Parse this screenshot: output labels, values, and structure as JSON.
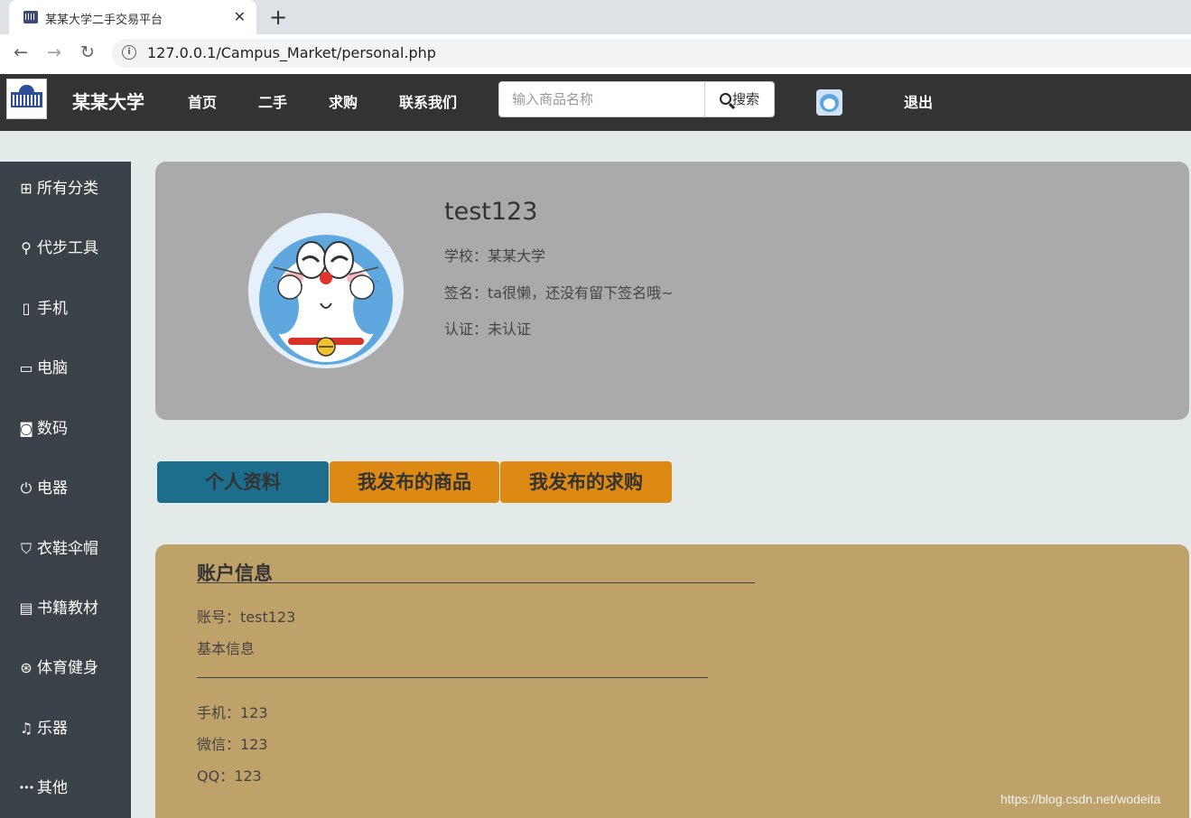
{
  "browser": {
    "tab_title": "某某大学二手交易平台",
    "tab_close": "✕",
    "new_tab": "+",
    "url": "127.0.0.1/Campus_Market/personal.php",
    "back": "←",
    "forward": "→",
    "reload": "↻"
  },
  "header": {
    "brand": "某某大学",
    "nav": [
      "首页",
      "二手",
      "求购",
      "联系我们"
    ],
    "search_placeholder": "输入商品名称",
    "search_button": "搜索",
    "logout": "退出"
  },
  "sidebar": {
    "items": [
      {
        "icon": "grid-icon",
        "glyph": "⊞",
        "label": "所有分类"
      },
      {
        "icon": "bicycle-icon",
        "glyph": "⚲",
        "label": "代步工具"
      },
      {
        "icon": "phone-icon",
        "glyph": "▯",
        "label": "手机"
      },
      {
        "icon": "monitor-icon",
        "glyph": "▭",
        "label": "电脑"
      },
      {
        "icon": "camera-icon",
        "glyph": "◙",
        "label": "数码"
      },
      {
        "icon": "plug-icon",
        "glyph": "⏻",
        "label": "电器"
      },
      {
        "icon": "shirt-icon",
        "glyph": "⛉",
        "label": "衣鞋伞帽"
      },
      {
        "icon": "book-icon",
        "glyph": "▤",
        "label": "书籍教材"
      },
      {
        "icon": "basketball-icon",
        "glyph": "⊛",
        "label": "体育健身"
      },
      {
        "icon": "guitar-icon",
        "glyph": "♫",
        "label": "乐器"
      },
      {
        "icon": "more-icon",
        "glyph": "•••",
        "label": "其他"
      }
    ]
  },
  "profile": {
    "username": "test123",
    "school_label": "学校：",
    "school": "某某大学",
    "signature_label": "签名：",
    "signature": "ta很懒，还没有留下签名哦~",
    "verify_label": "认证：",
    "verify": "未认证"
  },
  "tabs": [
    {
      "label": "个人资料",
      "active": true
    },
    {
      "label": "我发布的商品",
      "active": false
    },
    {
      "label": "我发布的求购",
      "active": false
    }
  ],
  "account": {
    "title": "账户信息",
    "account_line": "账号：test123",
    "basic_info": "基本信息",
    "phone": "手机：123",
    "wechat": "微信：123",
    "qq": "QQ：123"
  },
  "colors": {
    "header_bg": "#333333",
    "sidebar_bg": "#3a4149",
    "tab_active": "#1c6e8c",
    "tab_inactive": "#dd8a14",
    "account_bg": "#bfa26a",
    "profile_bg": "#aaaaaa"
  },
  "watermark": "https://blog.csdn.net/wodeita"
}
